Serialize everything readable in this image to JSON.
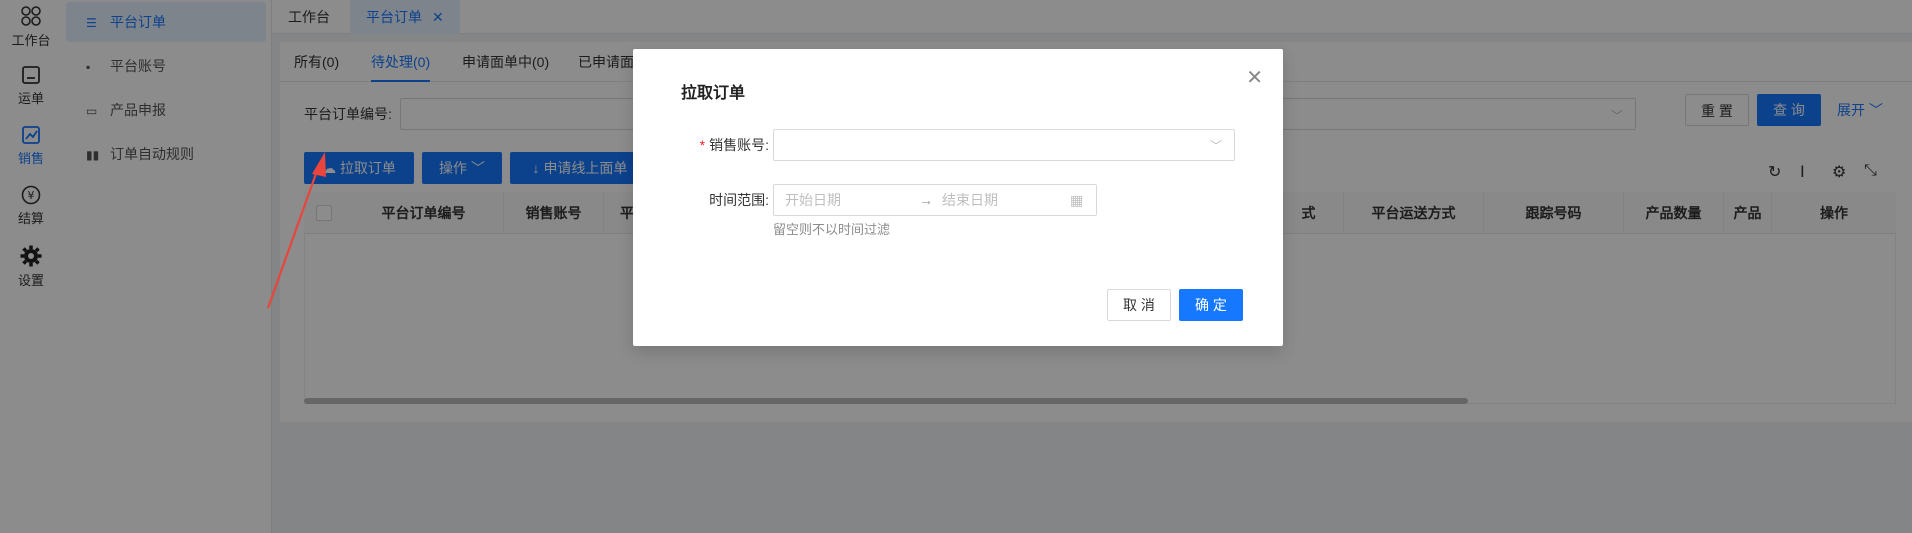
{
  "rail": {
    "items": [
      {
        "label": "工作台",
        "icon": "workbench-icon"
      },
      {
        "label": "运单",
        "icon": "waybill-icon"
      },
      {
        "label": "销售",
        "icon": "sales-icon"
      },
      {
        "label": "结算",
        "icon": "yen-icon"
      },
      {
        "label": "设置",
        "icon": "gear-icon"
      }
    ]
  },
  "submenu": {
    "items": [
      {
        "label": "平台订单",
        "icon": "list-icon"
      },
      {
        "label": "平台账号",
        "icon": "card-icon"
      },
      {
        "label": "产品申报",
        "icon": "monitor-icon"
      },
      {
        "label": "订单自动规则",
        "icon": "bars-icon"
      }
    ]
  },
  "tabs": [
    {
      "label": "工作台"
    },
    {
      "label": "平台订单"
    }
  ],
  "subtabs": [
    "所有(0)",
    "待处理(0)",
    "申请面单中(0)",
    "已申请面"
  ],
  "filter": {
    "label": "平台订单编号:",
    "reset": "重 置",
    "query": "查 询",
    "expand": "展开"
  },
  "toolbar": {
    "pull_orders": "拉取订单",
    "operate": "操作",
    "apply_label": "申请线上面单"
  },
  "table": {
    "columns": [
      "平台订单编号",
      "销售账号",
      "平",
      "式",
      "平台运送方式",
      "跟踪号码",
      "产品数量",
      "产品",
      "操作"
    ]
  },
  "modal": {
    "title": "拉取订单",
    "account_label": "销售账号:",
    "range_label": "时间范围:",
    "start_placeholder": "开始日期",
    "end_placeholder": "结束日期",
    "hint": "留空则不以时间过滤",
    "cancel": "取 消",
    "confirm": "确 定"
  },
  "colors": {
    "accent": "#1677ff",
    "required": "#f5222d",
    "annotation": "#e8453c"
  }
}
